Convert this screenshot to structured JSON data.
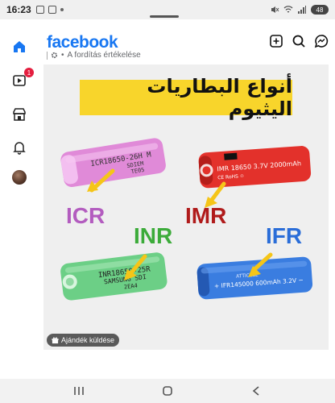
{
  "status": {
    "time": "16:23",
    "battery": "48"
  },
  "app": {
    "logo": "facebook"
  },
  "header": {
    "translate_text": "A fordítás értékelése"
  },
  "nav": {
    "rail": [
      {
        "id": "home",
        "icon": "home-icon"
      },
      {
        "id": "video",
        "icon": "video-icon",
        "badge": "1"
      },
      {
        "id": "marketplace",
        "icon": "store-icon"
      },
      {
        "id": "notifications",
        "icon": "bell-icon"
      },
      {
        "id": "profile",
        "icon": "avatar"
      }
    ]
  },
  "post": {
    "banner_text": "أنواع البطاريات اليثيوم",
    "batteries": [
      {
        "label": "ICR",
        "label_color": "#b35cbf",
        "body_color": "#e08ad8",
        "text": "ICR18650-26H M",
        "text2": "SDIEM",
        "text3": "TE05"
      },
      {
        "label": "IMR",
        "label_color": "#b01b1b",
        "body_color": "#e3312b",
        "text": "IMR 18650 3.7V 2000mAh",
        "text2": "CE RoHS"
      },
      {
        "label": "INR",
        "label_color": "#3cab3a",
        "body_color": "#6ccf86",
        "text": "INR18650-25R",
        "text2": "SAMSUNG SDI",
        "text3": "2EA4"
      },
      {
        "label": "IFR",
        "label_color": "#2a6dd8",
        "body_color": "#3a7de0",
        "text": "IFR145000 600mAh 3.2V"
      }
    ],
    "gift_label": "Ajándék küldése"
  }
}
